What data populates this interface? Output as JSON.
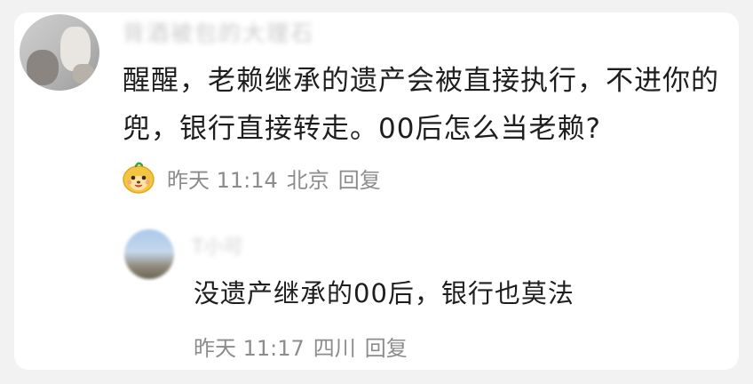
{
  "comment": {
    "username": "背酒被包的大理石",
    "text": "醒醒，老赖继承的遗产会被直接执行，不进你的兜，银行直接转走。00后怎么当老赖?",
    "meta": {
      "badge_icon": "smiling-mascot-icon",
      "time": "昨天 11:14",
      "location": "北京",
      "reply_label": "回复"
    }
  },
  "reply": {
    "username": "T小可",
    "text": "没遗产继承的00后，银行也莫法",
    "meta": {
      "time": "昨天 11:17",
      "location": "四川",
      "reply_label": "回复"
    }
  }
}
